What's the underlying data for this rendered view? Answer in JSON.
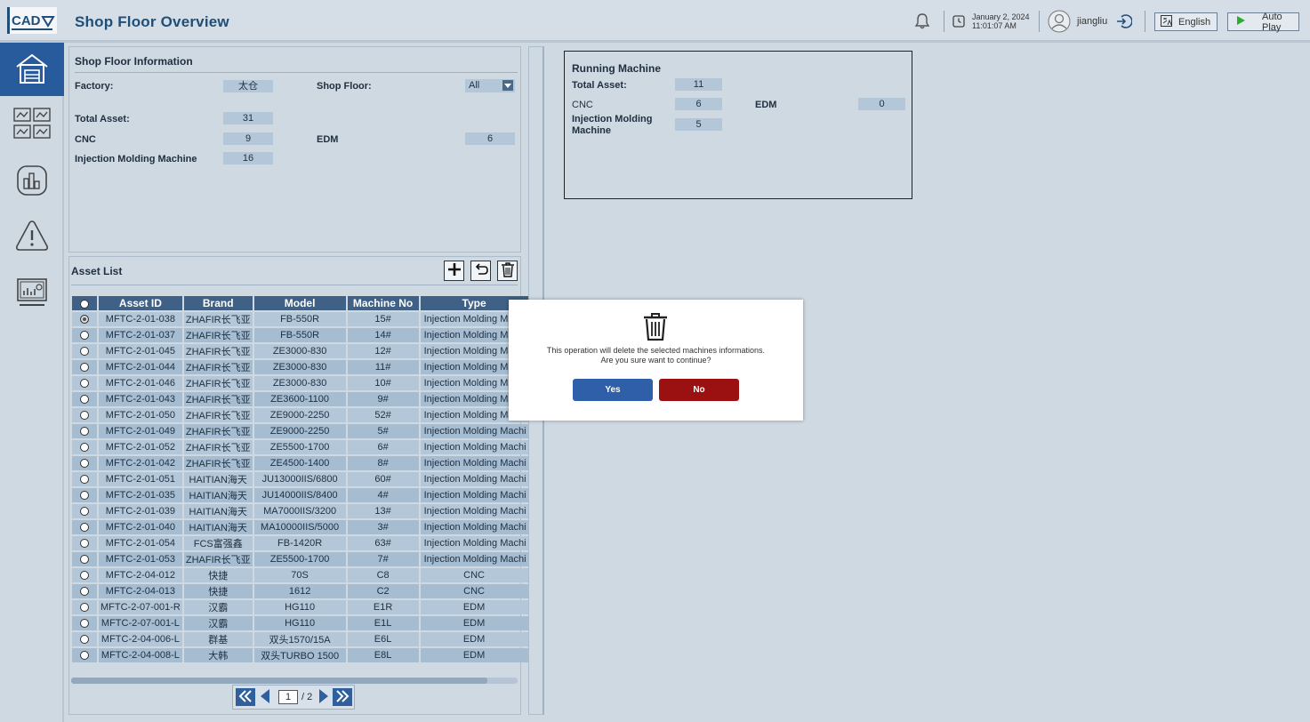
{
  "header": {
    "logo_text": "CAD",
    "title": "Shop Floor Overview",
    "date": "January 2, 2024",
    "time": "11:01:07 AM",
    "username": "jiangliu",
    "language_label": "English",
    "autoplay_label": "Auto Play"
  },
  "shop_floor_info": {
    "title": "Shop Floor Information",
    "factory_label": "Factory:",
    "factory_value": "太仓",
    "shop_floor_label": "Shop Floor:",
    "shop_floor_value": "All",
    "total_asset_label": "Total Asset:",
    "total_asset_value": "31",
    "cnc_label": "CNC",
    "cnc_value": "9",
    "edm_label": "EDM",
    "edm_value": "6",
    "imm_label": "Injection Molding Machine",
    "imm_value": "16"
  },
  "running_machine": {
    "title": "Running Machine",
    "total_asset_label": "Total Asset:",
    "total_asset_value": "11",
    "cnc_label": "CNC",
    "cnc_value": "6",
    "edm_label": "EDM",
    "edm_value": "0",
    "imm_label": "Injection Molding Machine",
    "imm_value": "5"
  },
  "asset_list": {
    "title": "Asset List",
    "columns": [
      "Asset ID",
      "Brand",
      "Model",
      "Machine No",
      "Type"
    ],
    "rows": [
      {
        "id": "MFTC-2-01-038",
        "brand": "ZHAFIR长飞亚",
        "model": "FB-550R",
        "no": "15#",
        "type": "Injection Molding Mach",
        "selected": true
      },
      {
        "id": "MFTC-2-01-037",
        "brand": "ZHAFIR长飞亚",
        "model": "FB-550R",
        "no": "14#",
        "type": "Injection Molding Mach",
        "selected": false
      },
      {
        "id": "MFTC-2-01-045",
        "brand": "ZHAFIR长飞亚",
        "model": "ZE3000-830",
        "no": "12#",
        "type": "Injection Molding Mac",
        "selected": false
      },
      {
        "id": "MFTC-2-01-044",
        "brand": "ZHAFIR长飞亚",
        "model": "ZE3000-830",
        "no": "11#",
        "type": "Injection Molding Mac",
        "selected": false
      },
      {
        "id": "MFTC-2-01-046",
        "brand": "ZHAFIR长飞亚",
        "model": "ZE3000-830",
        "no": "10#",
        "type": "Injection Molding Mac",
        "selected": false
      },
      {
        "id": "MFTC-2-01-043",
        "brand": "ZHAFIR长飞亚",
        "model": "ZE3600-1100",
        "no": "9#",
        "type": "Injection Molding Mac",
        "selected": false
      },
      {
        "id": "MFTC-2-01-050",
        "brand": "ZHAFIR长飞亚",
        "model": "ZE9000-2250",
        "no": "52#",
        "type": "Injection Molding Mac",
        "selected": false
      },
      {
        "id": "MFTC-2-01-049",
        "brand": "ZHAFIR长飞亚",
        "model": "ZE9000-2250",
        "no": "5#",
        "type": "Injection Molding Machi",
        "selected": false
      },
      {
        "id": "MFTC-2-01-052",
        "brand": "ZHAFIR长飞亚",
        "model": "ZE5500-1700",
        "no": "6#",
        "type": "Injection Molding Machi",
        "selected": false
      },
      {
        "id": "MFTC-2-01-042",
        "brand": "ZHAFIR长飞亚",
        "model": "ZE4500-1400",
        "no": "8#",
        "type": "Injection Molding Machi",
        "selected": false
      },
      {
        "id": "MFTC-2-01-051",
        "brand": "HAITIAN海天",
        "model": "JU13000IIS/6800",
        "no": "60#",
        "type": "Injection Molding Machi",
        "selected": false
      },
      {
        "id": "MFTC-2-01-035",
        "brand": "HAITIAN海天",
        "model": "JU14000IIS/8400",
        "no": "4#",
        "type": "Injection Molding Machi",
        "selected": false
      },
      {
        "id": "MFTC-2-01-039",
        "brand": "HAITIAN海天",
        "model": "MA7000IIS/3200",
        "no": "13#",
        "type": "Injection Molding Machi",
        "selected": false
      },
      {
        "id": "MFTC-2-01-040",
        "brand": "HAITIAN海天",
        "model": "MA10000IIS/5000",
        "no": "3#",
        "type": "Injection Molding Machi",
        "selected": false
      },
      {
        "id": "MFTC-2-01-054",
        "brand": "FCS富强鑫",
        "model": "FB-1420R",
        "no": "63#",
        "type": "Injection Molding Machi",
        "selected": false
      },
      {
        "id": "MFTC-2-01-053",
        "brand": "ZHAFIR长飞亚",
        "model": "ZE5500-1700",
        "no": "7#",
        "type": "Injection Molding Machi",
        "selected": false
      },
      {
        "id": "MFTC-2-04-012",
        "brand": "快捷",
        "model": "70S",
        "no": "C8",
        "type": "CNC",
        "selected": false
      },
      {
        "id": "MFTC-2-04-013",
        "brand": "快捷",
        "model": "1612",
        "no": "C2",
        "type": "CNC",
        "selected": false
      },
      {
        "id": "MFTC-2-07-001-R",
        "brand": "汉霸",
        "model": "HG110",
        "no": "E1R",
        "type": "EDM",
        "selected": false
      },
      {
        "id": "MFTC-2-07-001-L",
        "brand": "汉霸",
        "model": "HG110",
        "no": "E1L",
        "type": "EDM",
        "selected": false
      },
      {
        "id": "MFTC-2-04-006-L",
        "brand": "群基",
        "model": "双头1570/15A",
        "no": "E6L",
        "type": "EDM",
        "selected": false
      },
      {
        "id": "MFTC-2-04-008-L",
        "brand": "大韩",
        "model": "双头TURBO 1500",
        "no": "E8L",
        "type": "EDM",
        "selected": false
      }
    ],
    "pagination": {
      "current": "1",
      "total": "/ 2"
    }
  },
  "dialog": {
    "message_line1": "This operation will delete the selected machines informations.",
    "message_line2": "Are you sure want to continue?",
    "yes_label": "Yes",
    "no_label": "No"
  },
  "colors": {
    "accent": "#275b9c",
    "title": "#1f4e79",
    "yes": "#2f5fa8",
    "no": "#9b1111",
    "header_row": "#3f6185"
  }
}
